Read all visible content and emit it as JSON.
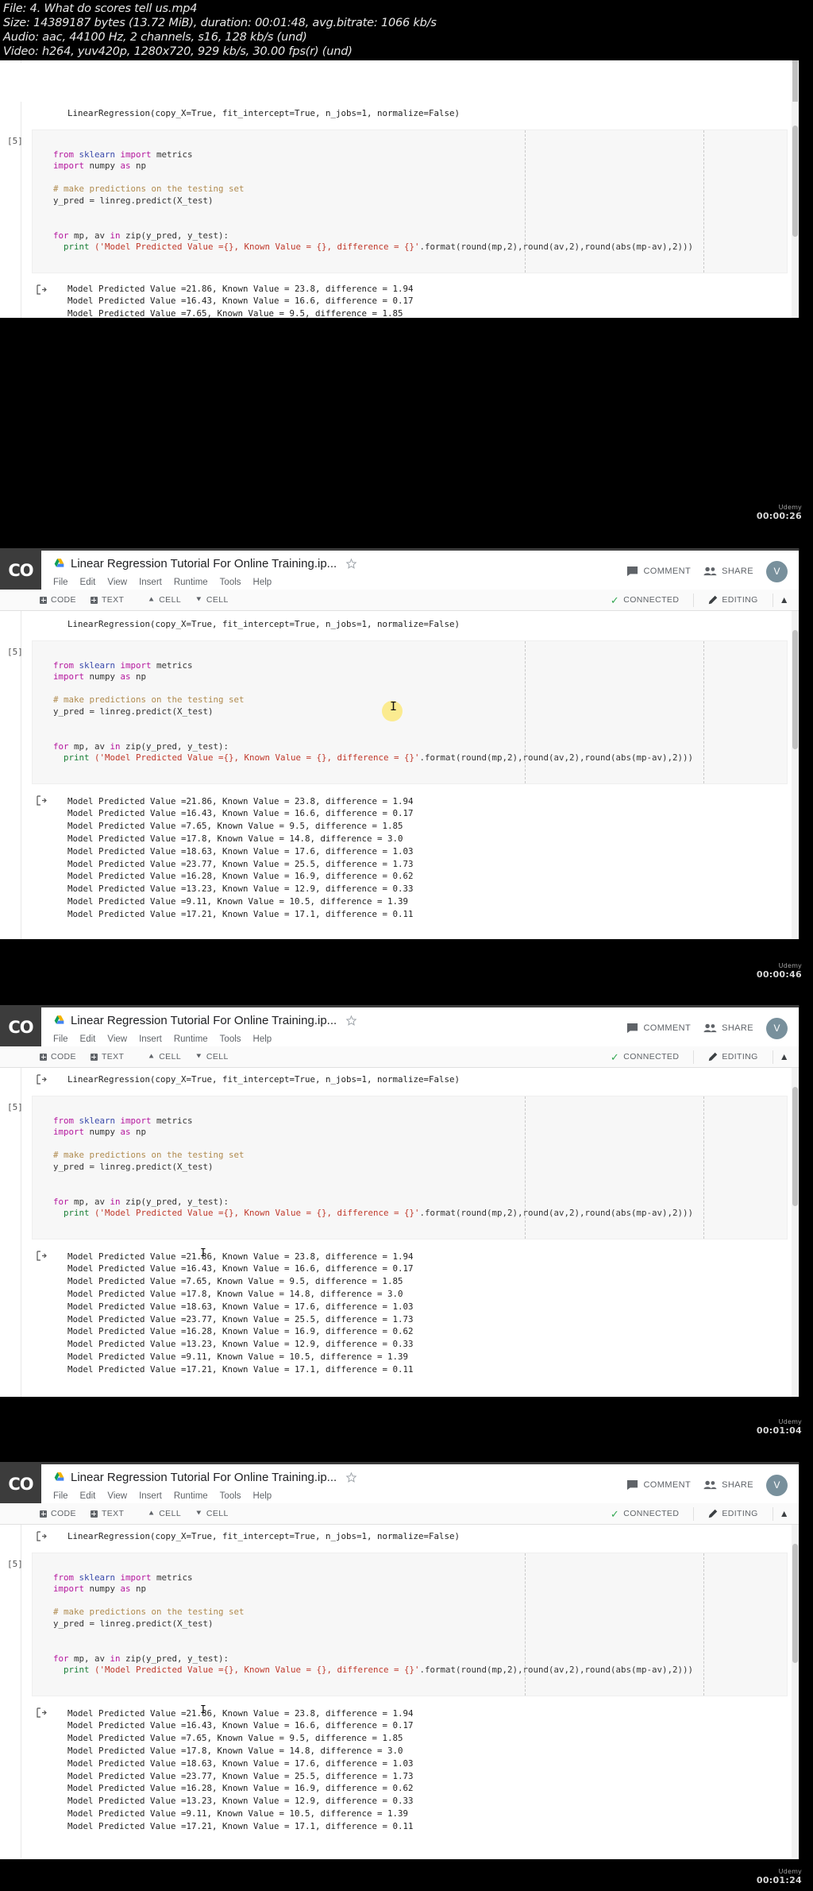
{
  "media_info": {
    "file": "File: 4. What do scores tell us.mp4",
    "size": "Size: 14389187 bytes (13.72 MiB), duration: 00:01:48, avg.bitrate: 1066 kb/s",
    "audio": "Audio: aac, 44100 Hz, 2 channels, s16, 128 kb/s (und)",
    "video": "Video: h264, yuv420p, 1280x720, 929 kb/s, 30.00 fps(r) (und)"
  },
  "colab": {
    "logo_text": "CO",
    "doc_title": "Linear Regression Tutorial For Online Training.ip...",
    "drive_icon": "drive-icon",
    "star_icon": "star-icon",
    "menus": [
      "File",
      "Edit",
      "View",
      "Insert",
      "Runtime",
      "Tools",
      "Help"
    ],
    "actions": {
      "comment": "COMMENT",
      "comment_icon": "comment-icon",
      "share": "SHARE",
      "share_icon": "people-icon",
      "avatar_initial": "V",
      "avatar_color": "#78909c"
    },
    "toolbar": {
      "code": "CODE",
      "text": "TEXT",
      "cell_up": "CELL",
      "cell_down": "CELL",
      "connected": "CONNECTED",
      "connected_color": "#34a853",
      "editing": "EDITING",
      "collapse_icon": "chevron-up-icon"
    }
  },
  "notebook": {
    "prior_output": "LinearRegression(copy_X=True, fit_intercept=True, n_jobs=1, normalize=False)",
    "cell_label": "[5]",
    "code": {
      "line1_kw": "from",
      "line1_mod": " sklearn ",
      "line1_kw2": "import",
      "line1_rest": " metrics",
      "line2_kw": "import",
      "line2_rest": " numpy ",
      "line2_as": "as",
      "line2_alias": " np",
      "comment": "# make predictions on the testing set",
      "assign": "y_pred = linreg.predict(X_test)",
      "for_kw": "for",
      "for_rest": " mp, av ",
      "for_in": "in",
      "for_zip": " zip(y_pred, y_test):",
      "print_kw": "  print",
      "print_str": " ('Model Predicted Value ={}, Known Value = {}, difference = {}'",
      "print_fmt": ".format(round(mp,2),round(av,2),round(abs(mp-av),2)))"
    },
    "output_prompt": "[→",
    "output_lines": [
      "Model Predicted Value =21.86, Known Value = 23.8, difference = 1.94",
      "Model Predicted Value =16.43, Known Value = 16.6, difference = 0.17",
      "Model Predicted Value =7.65, Known Value = 9.5, difference = 1.85",
      "Model Predicted Value =17.8, Known Value = 14.8, difference = 3.0",
      "Model Predicted Value =18.63, Known Value = 17.6, difference = 1.03",
      "Model Predicted Value =23.77, Known Value = 25.5, difference = 1.73",
      "Model Predicted Value =16.28, Known Value = 16.9, difference = 0.62",
      "Model Predicted Value =13.23, Known Value = 12.9, difference = 0.33",
      "Model Predicted Value =9.11, Known Value = 10.5, difference = 1.39",
      "Model Predicted Value =17.21, Known Value = 17.1, difference = 0.11"
    ]
  },
  "watermarks": [
    {
      "brand": "Udemy",
      "time": "00:00:26"
    },
    {
      "brand": "Udemy",
      "time": "00:00:46"
    },
    {
      "brand": "Udemy",
      "time": "00:01:04"
    },
    {
      "brand": "Udemy",
      "time": "00:01:24"
    }
  ]
}
